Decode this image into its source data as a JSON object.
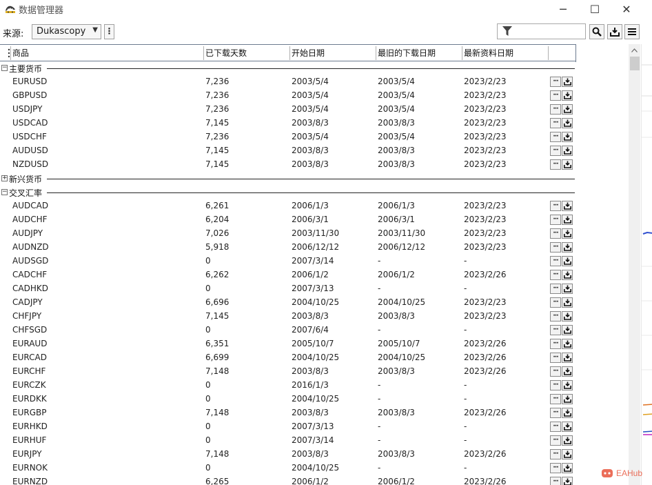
{
  "window": {
    "title": "数据管理器",
    "min_glyph": "─",
    "max_glyph": "☐",
    "close_glyph": "✕"
  },
  "toolbar": {
    "source_label": "来源:",
    "source_value": "Dukascopy",
    "menu_dots": "⋮",
    "filter_value": ""
  },
  "table": {
    "headers": [
      "商品",
      "已下载天数",
      "开始日期",
      "最旧的下载日期",
      "最新资料日期"
    ],
    "groups": [
      {
        "label": "主要货币",
        "expanded": true,
        "rows": [
          [
            "EURUSD",
            "7,236",
            "2003/5/4",
            "2003/5/4",
            "2023/2/23"
          ],
          [
            "GBPUSD",
            "7,236",
            "2003/5/4",
            "2003/5/4",
            "2023/2/23"
          ],
          [
            "USDJPY",
            "7,236",
            "2003/5/4",
            "2003/5/4",
            "2023/2/23"
          ],
          [
            "USDCAD",
            "7,145",
            "2003/8/3",
            "2003/8/3",
            "2023/2/23"
          ],
          [
            "USDCHF",
            "7,236",
            "2003/5/4",
            "2003/5/4",
            "2023/2/23"
          ],
          [
            "AUDUSD",
            "7,145",
            "2003/8/3",
            "2003/8/3",
            "2023/2/23"
          ],
          [
            "NZDUSD",
            "7,145",
            "2003/8/3",
            "2003/8/3",
            "2023/2/23"
          ]
        ]
      },
      {
        "label": "新兴货币",
        "expanded": false,
        "rows": []
      },
      {
        "label": "交叉汇率",
        "expanded": true,
        "rows": [
          [
            "AUDCAD",
            "6,261",
            "2006/1/3",
            "2006/1/3",
            "2023/2/23"
          ],
          [
            "AUDCHF",
            "6,204",
            "2006/3/1",
            "2006/3/1",
            "2023/2/23"
          ],
          [
            "AUDJPY",
            "7,026",
            "2003/11/30",
            "2003/11/30",
            "2023/2/23"
          ],
          [
            "AUDNZD",
            "5,918",
            "2006/12/12",
            "2006/12/12",
            "2023/2/23"
          ],
          [
            "AUDSGD",
            "0",
            "2007/3/14",
            "-",
            "-"
          ],
          [
            "CADCHF",
            "6,262",
            "2006/1/2",
            "2006/1/2",
            "2023/2/26"
          ],
          [
            "CADHKD",
            "0",
            "2007/3/13",
            "-",
            "-"
          ],
          [
            "CADJPY",
            "6,696",
            "2004/10/25",
            "2004/10/25",
            "2023/2/23"
          ],
          [
            "CHFJPY",
            "7,145",
            "2003/8/3",
            "2003/8/3",
            "2023/2/23"
          ],
          [
            "CHFSGD",
            "0",
            "2007/6/4",
            "-",
            "-"
          ],
          [
            "EURAUD",
            "6,351",
            "2005/10/7",
            "2005/10/7",
            "2023/2/26"
          ],
          [
            "EURCAD",
            "6,699",
            "2004/10/25",
            "2004/10/25",
            "2023/2/26"
          ],
          [
            "EURCHF",
            "7,148",
            "2003/8/3",
            "2003/8/3",
            "2023/2/26"
          ],
          [
            "EURCZK",
            "0",
            "2016/1/3",
            "-",
            "-"
          ],
          [
            "EURDKK",
            "0",
            "2004/10/25",
            "-",
            "-"
          ],
          [
            "EURGBP",
            "7,148",
            "2003/8/3",
            "2003/8/3",
            "2023/2/26"
          ],
          [
            "EURHKD",
            "0",
            "2007/3/13",
            "-",
            "-"
          ],
          [
            "EURHUF",
            "0",
            "2007/3/14",
            "-",
            "-"
          ],
          [
            "EURJPY",
            "7,148",
            "2003/8/3",
            "2003/8/3",
            "2023/2/26"
          ],
          [
            "EURNOK",
            "0",
            "2004/10/25",
            "-",
            "-"
          ],
          [
            "EURNZD",
            "6,265",
            "2006/1/2",
            "2006/1/2",
            "2023/2/26"
          ]
        ]
      }
    ],
    "row_more_glyph": "···"
  },
  "watermark": {
    "text": "EAHub"
  },
  "colors": {
    "header_border": "#6b7a8f",
    "button_border": "#888888",
    "watermark": "#e8553d"
  }
}
